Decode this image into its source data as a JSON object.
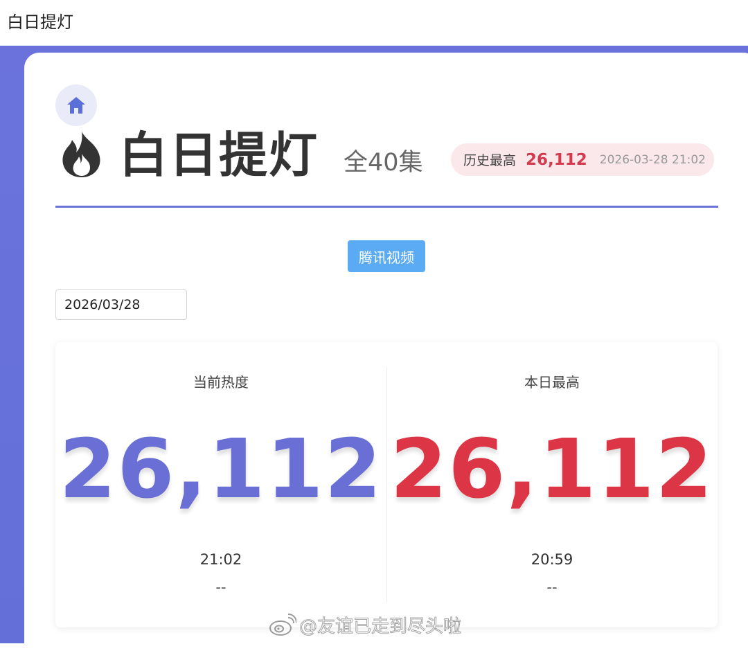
{
  "topbar": {
    "title": "白日提灯"
  },
  "header": {
    "title": "白日提灯",
    "episodes": "全40集",
    "record": {
      "label": "历史最高",
      "value": "26,112",
      "time": "2026-03-28 21:02"
    }
  },
  "platform": {
    "label": "腾讯视频"
  },
  "date_input": {
    "value": "2026/03/28"
  },
  "stats": {
    "current": {
      "label": "当前热度",
      "value": "26,112",
      "time": "21:02",
      "sub": "--",
      "color": "#6a6fd6"
    },
    "daily_high": {
      "label": "本日最高",
      "value": "26,112",
      "time": "20:59",
      "sub": "--",
      "color": "#dc3545"
    }
  },
  "watermark": {
    "text": "@友谊已走到尽头啦"
  },
  "colors": {
    "accent": "#6b72dc",
    "record_red": "#d43a4e",
    "platform_blue": "#5aaaf4"
  }
}
